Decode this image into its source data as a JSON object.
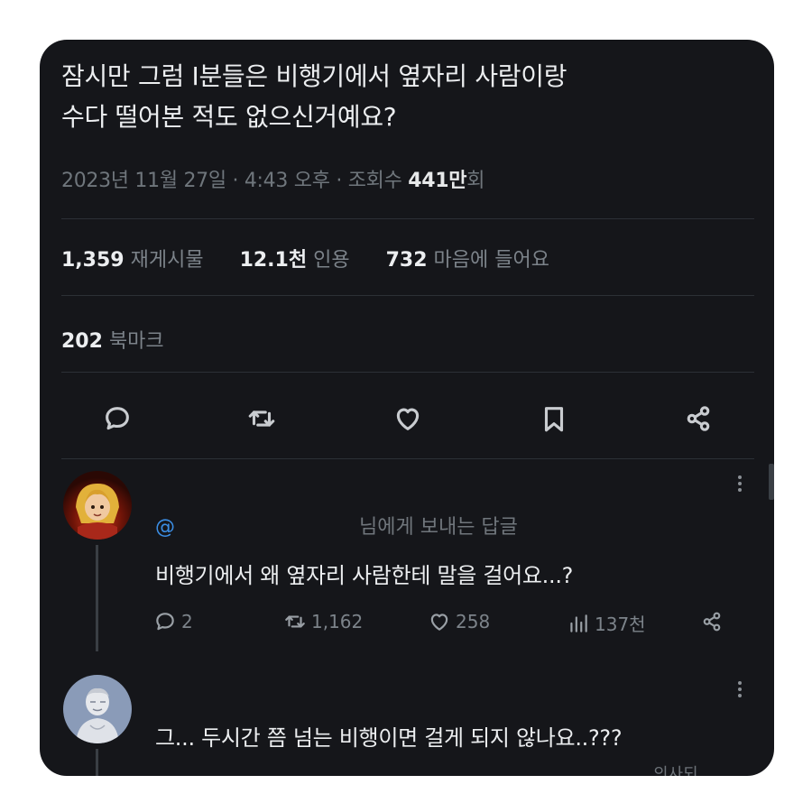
{
  "tweet": {
    "line1": "잠시만 그럼 I분들은 비행기에서 옆자리 사람이랑",
    "line2": "수다 떨어본 적도 없으신거예요?",
    "meta_prefix": "2023년 11월 27일 · 4:43 오후 · 조회수 ",
    "views_num": "441만",
    "views_suffix": "회"
  },
  "stats": {
    "retweets_num": "1,359",
    "retweets_label": "재게시물",
    "quotes_num": "12.1천",
    "quotes_label": "인용",
    "likes_num": "732",
    "likes_label": "마음에 들어요",
    "bookmarks_num": "202",
    "bookmarks_label": "북마크"
  },
  "actions": [
    "reply-icon",
    "retweet-icon",
    "heart-icon",
    "bookmark-icon",
    "share-icon"
  ],
  "reply1": {
    "handle": "@",
    "to_label": "님에게 보내는 답글",
    "text": "비행기에서 왜 옆자리 사람한테 말을 걸어요...?",
    "replies": "2",
    "retweets": "1,162",
    "likes": "258",
    "views": "137천"
  },
  "reply2": {
    "text": "그... 두시간 쯤 넘는 비행이면 걸게 되지 않나요..???",
    "cut_label": "의사되"
  },
  "colors": {
    "background": "#15161a",
    "text": "#e7e9ea",
    "muted": "#6f767c",
    "link": "#3b8ee5"
  }
}
